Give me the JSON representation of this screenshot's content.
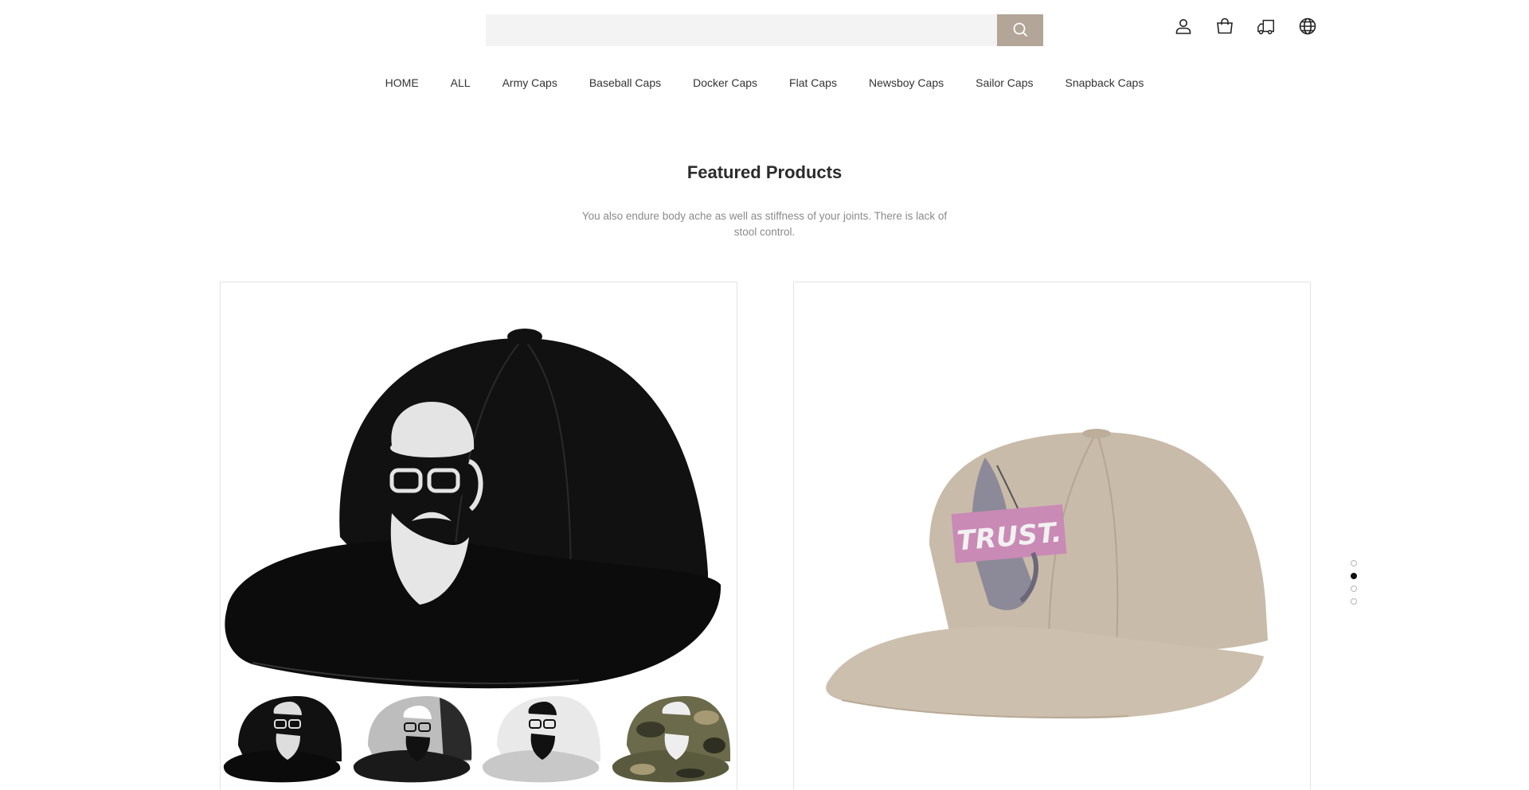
{
  "search": {
    "placeholder": "",
    "value": ""
  },
  "header_icons": [
    "account-icon",
    "cart-icon",
    "shipping-icon",
    "language-icon"
  ],
  "nav": {
    "items": [
      "HOME",
      "ALL",
      "Army Caps",
      "Baseball Caps",
      "Docker Caps",
      "Flat Caps",
      "Newsboy Caps",
      "Sailor Caps",
      "Snapback Caps"
    ]
  },
  "featured": {
    "title": "Featured Products",
    "subtitle": "You also endure body ache as well as stiffness of your joints. There is lack of stool control."
  },
  "products": [
    {
      "image": "black-snapback-bearded-man-cap",
      "variants": [
        "black-mesh",
        "grey-mesh",
        "white-grey",
        "camo"
      ]
    },
    {
      "image": "khaki-trust-praying-hands-cap",
      "patch_text": "TRUST."
    }
  ],
  "pager": {
    "count": 4,
    "active_index": 1
  },
  "colors": {
    "search_button": "#b3a597",
    "patch": "#c98ab6",
    "khaki": "#c7b9a7"
  }
}
